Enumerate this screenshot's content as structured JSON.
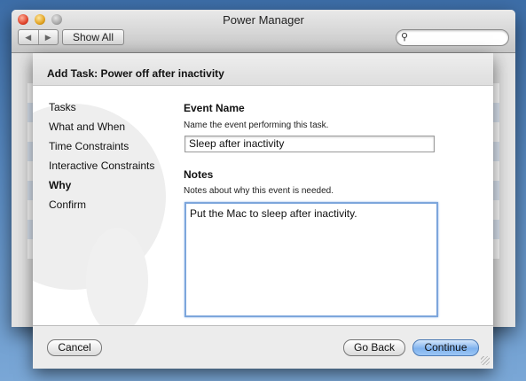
{
  "window": {
    "title": "Power Manager",
    "toolbar": {
      "back": "◀",
      "forward": "▶",
      "show_all": "Show All",
      "search_placeholder": ""
    }
  },
  "sheet": {
    "title": "Add Task: Power off after inactivity",
    "steps": [
      "Tasks",
      "What and When",
      "Time Constraints",
      "Interactive Constraints",
      "Why",
      "Confirm"
    ],
    "active_step": "Why",
    "event_name": {
      "title": "Event Name",
      "description": "Name the event performing this task.",
      "value": "Sleep after inactivity"
    },
    "notes": {
      "title": "Notes",
      "description": "Notes about why this event is needed.",
      "value": "Put the Mac to sleep after inactivity."
    },
    "buttons": {
      "cancel": "Cancel",
      "go_back": "Go Back",
      "continue": "Continue"
    }
  },
  "colors": {
    "accent": "#7fb2ee",
    "focus_ring": "#7da6dc",
    "desktop": "#5a8cc4"
  }
}
